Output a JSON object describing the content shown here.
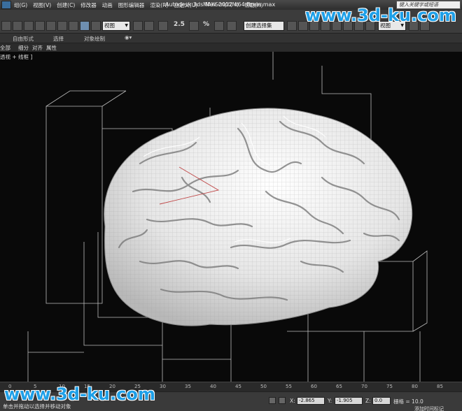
{
  "window": {
    "title": "Autodesk 3ds Max  2012 x64     Brain.max",
    "search_placeholder": "键入关键字或短语"
  },
  "menu": [
    "组(G)",
    "视图(V)",
    "创建(C)",
    "修改器",
    "动画",
    "图形编辑器",
    "渲染(R)",
    "自定义(U)",
    "MAXScript(M)",
    "帮助(H)"
  ],
  "toolbar": {
    "reference_coord_value": "视图",
    "selection_set_placeholder": "创建选择集",
    "view_dropdown_value": "视图",
    "snap_label": "2.5",
    "angle_snap_label": "%"
  },
  "ribbon": {
    "tabs": [
      "自由形式",
      "选择",
      "对象绘制"
    ]
  },
  "subtabs": [
    "全部",
    "细分",
    "对齐",
    "属性"
  ],
  "viewport": {
    "label": "透视 + 线框 ]",
    "object": "Brain"
  },
  "timeline": {
    "ticks": [
      "0",
      "5",
      "10",
      "15",
      "20",
      "25",
      "30",
      "35",
      "40",
      "45",
      "50",
      "55",
      "60",
      "65",
      "70",
      "75",
      "80",
      "85"
    ]
  },
  "status": {
    "prompt": "单击并拖动以选择并移动对象",
    "x_label": "X:",
    "x_value": "-2.865",
    "y_label": "Y:",
    "y_value": "-1.905",
    "z_label": "Z:",
    "z_value": "0.0",
    "grid_label": "栅格 = 10.0",
    "add_time_tag": "添加时间标记"
  },
  "watermarks": {
    "top": "www.3d-ku.com",
    "bottom": "www.3d-ku.com"
  },
  "colors": {
    "viewport_bg": "#090909",
    "mesh": "#eeeeee",
    "watermark": "#1ea0e8"
  }
}
